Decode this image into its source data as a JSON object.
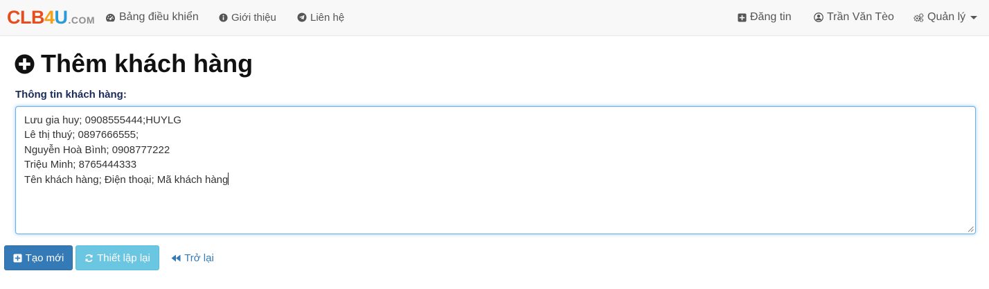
{
  "brand": {
    "part1": "CLB",
    "part2": "4",
    "part3": "U",
    "suffix": ".COM"
  },
  "nav_left": {
    "dashboard": "Bảng điều khiển",
    "about": "Giới thiệu",
    "contact": "Liên hệ"
  },
  "nav_right": {
    "post": "Đăng tin",
    "user": "Trần Văn Tèo",
    "manage": "Quản lý"
  },
  "page": {
    "title": "Thêm khách hàng",
    "field_label": "Thông tin khách hàng:"
  },
  "customer_input": {
    "lines": [
      "Lưu gia huy; 0908555444;HUYLG",
      "Lê thị thuý; 0897666555;",
      "Nguyễn Hoà Bình; 0908777222",
      "Triệu Minh; 8765444333",
      "Tên khách hàng; Điện thoại; Mã khách hàng"
    ]
  },
  "buttons": {
    "create": "Tạo mới",
    "reset": "Thiết lập lại",
    "back": "Trở lại"
  },
  "colors": {
    "primary": "#337ab7",
    "info": "#5bc0de",
    "focus_border": "#66afe9",
    "label": "#1a2a5a"
  },
  "icons": {
    "dashboard": "dashboard-icon",
    "about": "info-circle-icon",
    "contact": "telegram-icon",
    "post": "plus-square-icon",
    "user": "user-circle-icon",
    "manage": "gears-icon",
    "title": "plus-circle-icon",
    "create": "plus-square-icon",
    "reset": "refresh-icon",
    "back": "backward-icon"
  }
}
